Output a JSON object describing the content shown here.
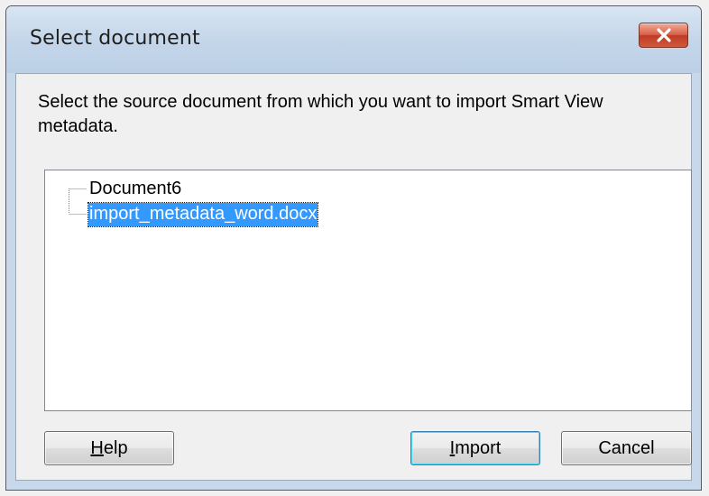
{
  "window": {
    "title": "Select document",
    "close_icon": "close-icon"
  },
  "dialog": {
    "instruction": "Select the source document from which you want to import Smart View metadata."
  },
  "tree": {
    "items": [
      {
        "label": "Document6",
        "selected": false
      },
      {
        "label": "import_metadata_word.docx",
        "selected": true
      }
    ],
    "selection_color": "#3399ff"
  },
  "buttons": {
    "help": {
      "mnemonic": "H",
      "rest": "elp"
    },
    "import": {
      "mnemonic": "I",
      "rest": "mport"
    },
    "cancel": {
      "label": "Cancel"
    }
  }
}
